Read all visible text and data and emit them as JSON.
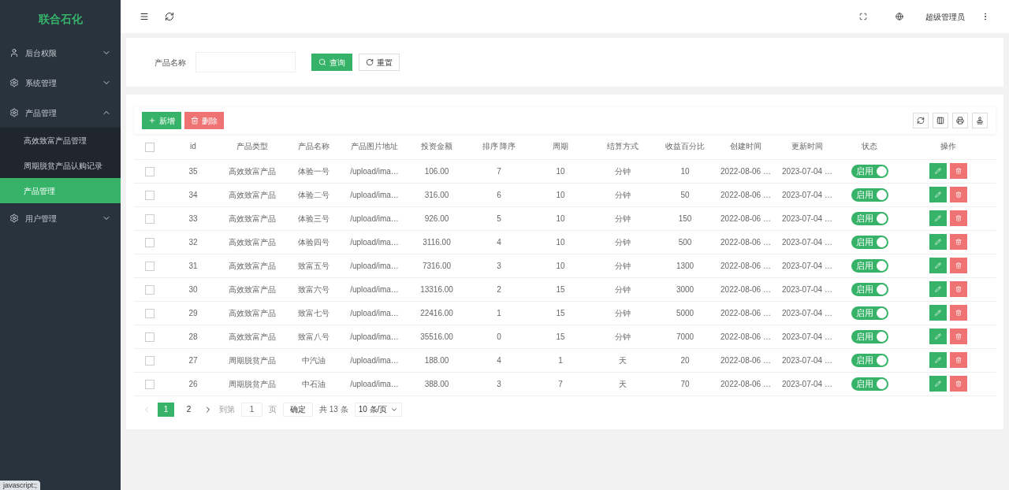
{
  "sidebar": {
    "logo": "联合石化",
    "items": [
      {
        "label": "后台权限",
        "kind": "user",
        "expanded": false
      },
      {
        "label": "系统管理",
        "kind": "gear",
        "expanded": false
      },
      {
        "label": "产品管理",
        "kind": "gear",
        "expanded": true,
        "children": [
          {
            "label": "高效致富产品管理",
            "selected": false
          },
          {
            "label": "周期脱贫产品认购记录",
            "selected": false
          },
          {
            "label": "产品管理",
            "selected": true
          }
        ]
      },
      {
        "label": "用户管理",
        "kind": "gear",
        "expanded": false
      }
    ]
  },
  "header": {
    "user": "超级管理员"
  },
  "search": {
    "label": "产品名称",
    "buttons": [
      {
        "label": "查询",
        "kind": "primary"
      },
      {
        "label": "重置",
        "kind": "reset"
      }
    ]
  },
  "toolbar": {
    "buttons": [
      {
        "label": "新增",
        "kind": "add"
      },
      {
        "label": "删除",
        "kind": "delete"
      }
    ]
  },
  "table": {
    "all_checked": false,
    "columns": [
      "id",
      "产品类型",
      "产品名称",
      "产品图片地址",
      "投资金额",
      "排序 降序",
      "周期",
      "结算方式",
      "收益百分比",
      "创建时间",
      "更新时间",
      "状态",
      "操作"
    ],
    "rows": [
      {
        "checked": false,
        "cells": [
          "35",
          "高效致富产品",
          "体验一号",
          "/upload/ima…",
          "106.00",
          "7",
          "10",
          "分钟",
          "10",
          "2022-08-06 …",
          "2023-07-04 …"
        ],
        "status": {
          "label": "启用",
          "on": true
        }
      },
      {
        "checked": false,
        "cells": [
          "34",
          "高效致富产品",
          "体验二号",
          "/upload/ima…",
          "316.00",
          "6",
          "10",
          "分钟",
          "50",
          "2022-08-06 …",
          "2023-07-04 …"
        ],
        "status": {
          "label": "启用",
          "on": true
        }
      },
      {
        "checked": false,
        "cells": [
          "33",
          "高效致富产品",
          "体验三号",
          "/upload/ima…",
          "926.00",
          "5",
          "10",
          "分钟",
          "150",
          "2022-08-06 …",
          "2023-07-04 …"
        ],
        "status": {
          "label": "启用",
          "on": true
        }
      },
      {
        "checked": false,
        "cells": [
          "32",
          "高效致富产品",
          "体验四号",
          "/upload/ima…",
          "3116.00",
          "4",
          "10",
          "分钟",
          "500",
          "2022-08-06 …",
          "2023-07-04 …"
        ],
        "status": {
          "label": "启用",
          "on": true
        }
      },
      {
        "checked": false,
        "cells": [
          "31",
          "高效致富产品",
          "致富五号",
          "/upload/ima…",
          "7316.00",
          "3",
          "10",
          "分钟",
          "1300",
          "2022-08-06 …",
          "2023-07-04 …"
        ],
        "status": {
          "label": "启用",
          "on": true
        }
      },
      {
        "checked": false,
        "cells": [
          "30",
          "高效致富产品",
          "致富六号",
          "/upload/ima…",
          "13316.00",
          "2",
          "15",
          "分钟",
          "3000",
          "2022-08-06 …",
          "2023-07-04 …"
        ],
        "status": {
          "label": "启用",
          "on": true
        }
      },
      {
        "checked": false,
        "cells": [
          "29",
          "高效致富产品",
          "致富七号",
          "/upload/ima…",
          "22416.00",
          "1",
          "15",
          "分钟",
          "5000",
          "2022-08-06 …",
          "2023-07-04 …"
        ],
        "status": {
          "label": "启用",
          "on": true
        }
      },
      {
        "checked": false,
        "cells": [
          "28",
          "高效致富产品",
          "致富八号",
          "/upload/ima…",
          "35516.00",
          "0",
          "15",
          "分钟",
          "7000",
          "2022-08-06 …",
          "2023-07-04 …"
        ],
        "status": {
          "label": "启用",
          "on": true
        }
      },
      {
        "checked": false,
        "cells": [
          "27",
          "周期脱贫产品",
          "中汽油",
          "/upload/ima…",
          "188.00",
          "4",
          "1",
          "天",
          "20",
          "2022-08-06 …",
          "2023-07-04 …"
        ],
        "status": {
          "label": "启用",
          "on": true
        }
      },
      {
        "checked": false,
        "cells": [
          "26",
          "周期脱贫产品",
          "中石油",
          "/upload/ima…",
          "388.00",
          "3",
          "7",
          "天",
          "70",
          "2022-08-06 …",
          "2023-07-04 …"
        ],
        "status": {
          "label": "启用",
          "on": true
        }
      }
    ]
  },
  "pagination": {
    "pages": [
      {
        "label": "1",
        "selected": true
      },
      {
        "label": "2",
        "selected": false
      }
    ],
    "goto_label": "到第",
    "goto_value": "1",
    "page_unit": "页",
    "confirm": "确定",
    "total": "共 13 条",
    "page_size": "10 条/页"
  },
  "status_bar": "javascript:;"
}
